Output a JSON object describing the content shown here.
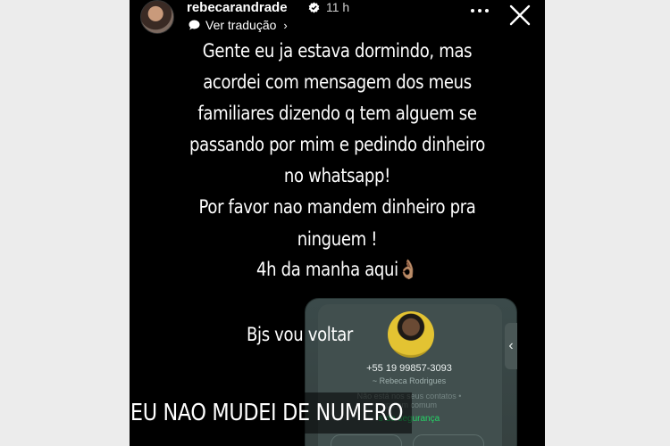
{
  "header": {
    "username": "rebecarandrade",
    "time": "11 h",
    "translate_label": "Ver tradução",
    "chevron": "›",
    "avatar_icon": "profile-photo",
    "verified_icon": "verified-badge-icon",
    "more_icon": "more-dots-icon",
    "close_icon": "close-icon"
  },
  "story": {
    "lines": [
      "Gente eu ja estava dormindo, mas",
      "acordei com mensagem dos meus",
      "familiares dizendo q tem alguem se",
      "passando por mim e pedindo dinheiro",
      "no whatsapp!",
      "Por favor nao mandem dinheiro pra",
      "ninguem !",
      "4h da manha aqui👌🏽",
      "Bjs vou voltar"
    ],
    "caption": "EU NAO MUDEI DE NUMERO"
  },
  "whatsapp_card": {
    "phone": "+55 19 99857-3093",
    "name": "~ Rebeca Rodrigues",
    "line1": "Não está nos seus contatos •",
    "line2": "upo em comum",
    "safety": "s de segurança",
    "arrow": "‹"
  },
  "colors": {
    "background": "#000000",
    "side_panels": "#ececec",
    "whatsapp_green": "#25d366"
  }
}
